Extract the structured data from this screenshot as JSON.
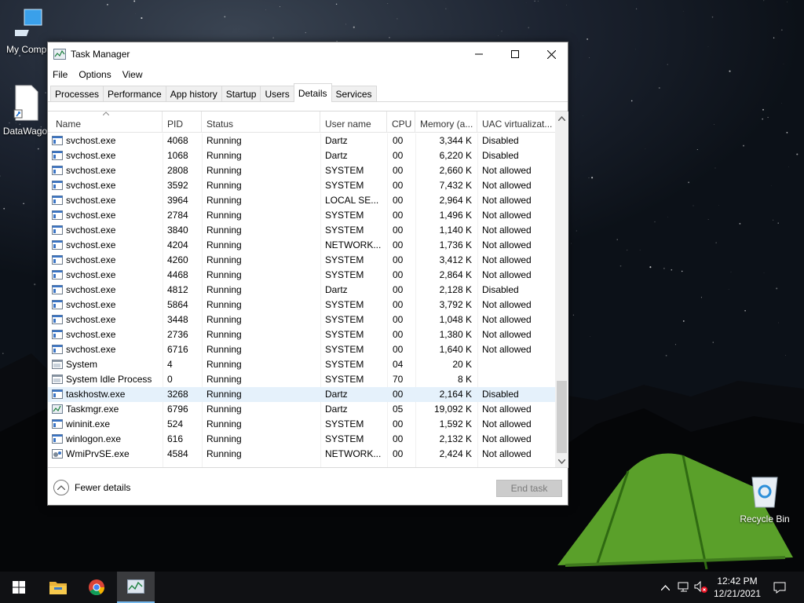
{
  "desktop": {
    "icons": [
      {
        "label": "My Compu",
        "icon": "computer-icon"
      },
      {
        "label": "DataWago",
        "icon": "file-shortcut-icon"
      },
      {
        "label": "Recycle Bin",
        "icon": "recycle-bin-icon"
      }
    ]
  },
  "window": {
    "title": "Task Manager",
    "menu": [
      "File",
      "Options",
      "View"
    ],
    "tabs": [
      "Processes",
      "Performance",
      "App history",
      "Startup",
      "Users",
      "Details",
      "Services"
    ],
    "active_tab": "Details",
    "columns": [
      "Name",
      "PID",
      "Status",
      "User name",
      "CPU",
      "Memory (a...",
      "UAC virtualizat..."
    ],
    "rows": [
      {
        "name": "svchost.exe",
        "pid": "4068",
        "status": "Running",
        "user": "Dartz",
        "cpu": "00",
        "mem": "3,344 K",
        "uac": "Disabled",
        "icon": "service-icon"
      },
      {
        "name": "svchost.exe",
        "pid": "1068",
        "status": "Running",
        "user": "Dartz",
        "cpu": "00",
        "mem": "6,220 K",
        "uac": "Disabled",
        "icon": "service-icon"
      },
      {
        "name": "svchost.exe",
        "pid": "2808",
        "status": "Running",
        "user": "SYSTEM",
        "cpu": "00",
        "mem": "2,660 K",
        "uac": "Not allowed",
        "icon": "service-icon"
      },
      {
        "name": "svchost.exe",
        "pid": "3592",
        "status": "Running",
        "user": "SYSTEM",
        "cpu": "00",
        "mem": "7,432 K",
        "uac": "Not allowed",
        "icon": "service-icon"
      },
      {
        "name": "svchost.exe",
        "pid": "3964",
        "status": "Running",
        "user": "LOCAL SE...",
        "cpu": "00",
        "mem": "2,964 K",
        "uac": "Not allowed",
        "icon": "service-icon"
      },
      {
        "name": "svchost.exe",
        "pid": "2784",
        "status": "Running",
        "user": "SYSTEM",
        "cpu": "00",
        "mem": "1,496 K",
        "uac": "Not allowed",
        "icon": "service-icon"
      },
      {
        "name": "svchost.exe",
        "pid": "3840",
        "status": "Running",
        "user": "SYSTEM",
        "cpu": "00",
        "mem": "1,140 K",
        "uac": "Not allowed",
        "icon": "service-icon"
      },
      {
        "name": "svchost.exe",
        "pid": "4204",
        "status": "Running",
        "user": "NETWORK...",
        "cpu": "00",
        "mem": "1,736 K",
        "uac": "Not allowed",
        "icon": "service-icon"
      },
      {
        "name": "svchost.exe",
        "pid": "4260",
        "status": "Running",
        "user": "SYSTEM",
        "cpu": "00",
        "mem": "3,412 K",
        "uac": "Not allowed",
        "icon": "service-icon"
      },
      {
        "name": "svchost.exe",
        "pid": "4468",
        "status": "Running",
        "user": "SYSTEM",
        "cpu": "00",
        "mem": "2,864 K",
        "uac": "Not allowed",
        "icon": "service-icon"
      },
      {
        "name": "svchost.exe",
        "pid": "4812",
        "status": "Running",
        "user": "Dartz",
        "cpu": "00",
        "mem": "2,128 K",
        "uac": "Disabled",
        "icon": "service-icon"
      },
      {
        "name": "svchost.exe",
        "pid": "5864",
        "status": "Running",
        "user": "SYSTEM",
        "cpu": "00",
        "mem": "3,792 K",
        "uac": "Not allowed",
        "icon": "service-icon"
      },
      {
        "name": "svchost.exe",
        "pid": "3448",
        "status": "Running",
        "user": "SYSTEM",
        "cpu": "00",
        "mem": "1,048 K",
        "uac": "Not allowed",
        "icon": "service-icon"
      },
      {
        "name": "svchost.exe",
        "pid": "2736",
        "status": "Running",
        "user": "SYSTEM",
        "cpu": "00",
        "mem": "1,380 K",
        "uac": "Not allowed",
        "icon": "service-icon"
      },
      {
        "name": "svchost.exe",
        "pid": "6716",
        "status": "Running",
        "user": "SYSTEM",
        "cpu": "00",
        "mem": "1,640 K",
        "uac": "Not allowed",
        "icon": "service-icon"
      },
      {
        "name": "System",
        "pid": "4",
        "status": "Running",
        "user": "SYSTEM",
        "cpu": "04",
        "mem": "20 K",
        "uac": "",
        "icon": "system-icon"
      },
      {
        "name": "System Idle Process",
        "pid": "0",
        "status": "Running",
        "user": "SYSTEM",
        "cpu": "70",
        "mem": "8 K",
        "uac": "",
        "icon": "system-icon"
      },
      {
        "name": "taskhostw.exe",
        "pid": "3268",
        "status": "Running",
        "user": "Dartz",
        "cpu": "00",
        "mem": "2,164 K",
        "uac": "Disabled",
        "icon": "service-icon",
        "selected": true
      },
      {
        "name": "Taskmgr.exe",
        "pid": "6796",
        "status": "Running",
        "user": "Dartz",
        "cpu": "05",
        "mem": "19,092 K",
        "uac": "Not allowed",
        "icon": "task-manager-icon"
      },
      {
        "name": "wininit.exe",
        "pid": "524",
        "status": "Running",
        "user": "SYSTEM",
        "cpu": "00",
        "mem": "1,592 K",
        "uac": "Not allowed",
        "icon": "service-icon"
      },
      {
        "name": "winlogon.exe",
        "pid": "616",
        "status": "Running",
        "user": "SYSTEM",
        "cpu": "00",
        "mem": "2,132 K",
        "uac": "Not allowed",
        "icon": "service-icon"
      },
      {
        "name": "WmiPrvSE.exe",
        "pid": "4584",
        "status": "Running",
        "user": "NETWORK...",
        "cpu": "00",
        "mem": "2,424 K",
        "uac": "Not allowed",
        "icon": "wmi-icon"
      }
    ],
    "footer": {
      "fewer_details": "Fewer details",
      "end_task": "End task"
    }
  },
  "taskbar": {
    "items": [
      "start-icon",
      "file-explorer-icon",
      "chrome-icon",
      "task-manager-icon"
    ],
    "active_item": "task-manager-icon",
    "clock_time": "12:42 PM",
    "clock_date": "12/21/2021"
  },
  "colors": {
    "selection": "#e5f1fb",
    "taskbar": "#101114",
    "accent": "#76b9ed"
  }
}
